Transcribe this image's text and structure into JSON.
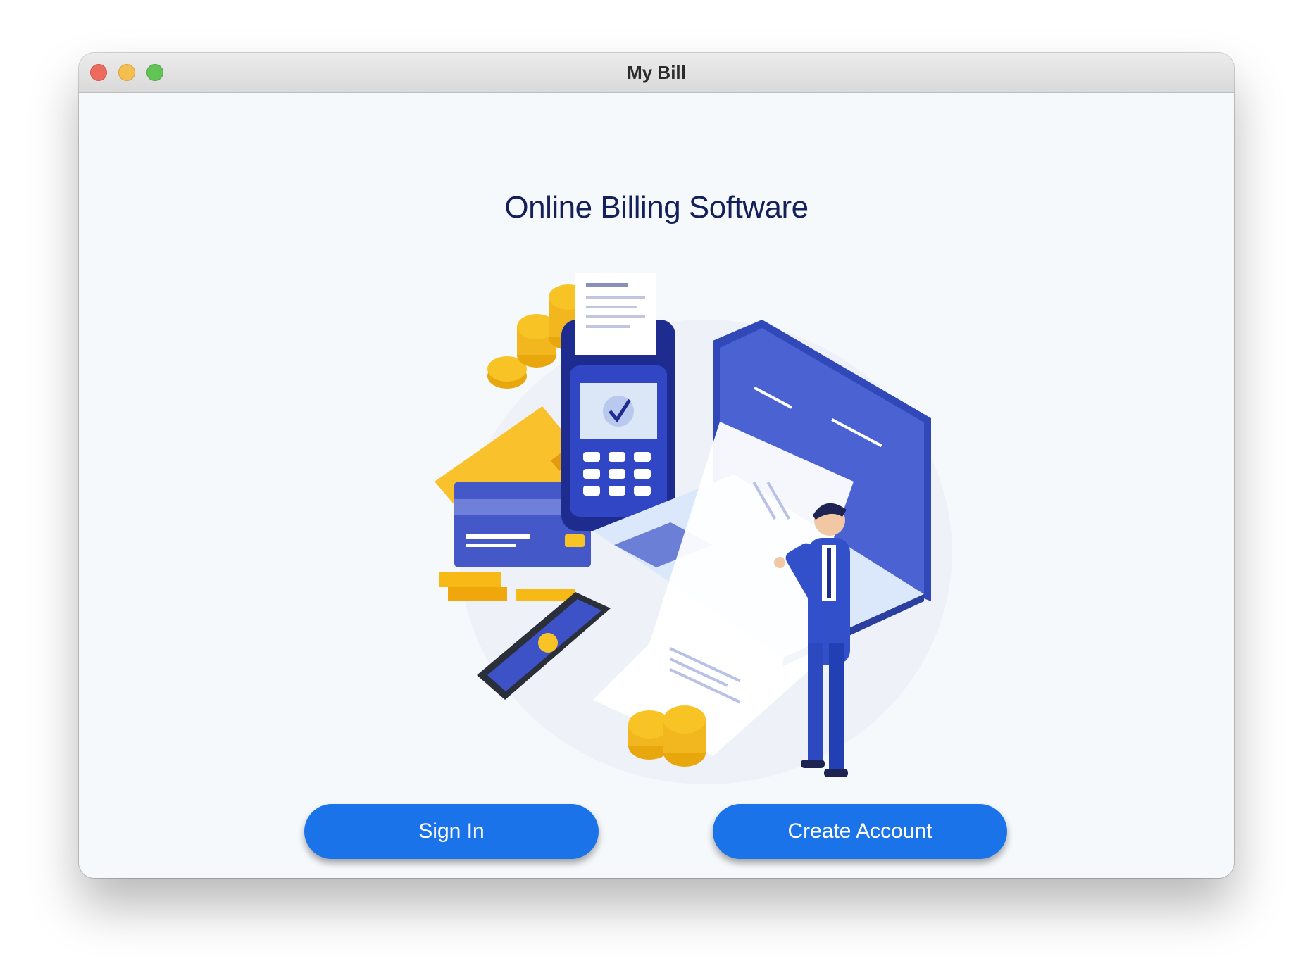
{
  "window": {
    "title": "My Bill"
  },
  "main": {
    "heading": "Online Billing Software",
    "illustration": "billing-illustration",
    "buttons": {
      "sign_in": "Sign In",
      "create_account": "Create Account"
    }
  },
  "colors": {
    "primary_button": "#1a73e8",
    "heading": "#15205a",
    "background": "#f6f9fc",
    "illustration_blue": "#3d52c7",
    "illustration_gold": "#f7c325"
  }
}
